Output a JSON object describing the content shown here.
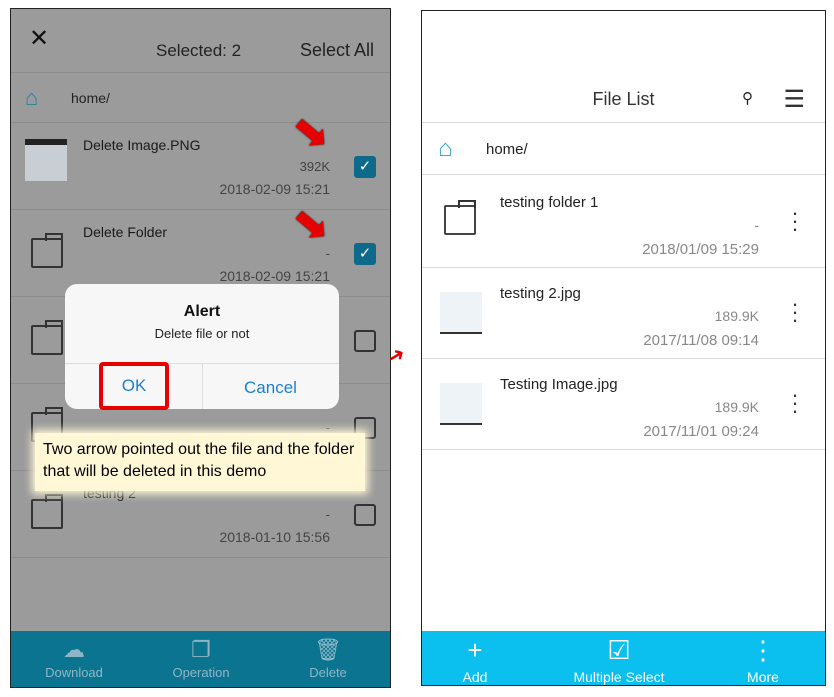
{
  "left": {
    "header": {
      "close_icon": "x",
      "selected": "Selected: 2",
      "select_all": "Select All"
    },
    "path": "home/",
    "rows": [
      {
        "name": "Delete Image.PNG",
        "size": "392K",
        "date": "2018-02-09 15:21",
        "checked": true
      },
      {
        "name": "Delete Folder",
        "size": "-",
        "date": "2018-02-09 15:21",
        "checked": true
      },
      {
        "name": "",
        "size": "",
        "date": "",
        "checked": false
      },
      {
        "name": "",
        "size": "-",
        "date": "",
        "checked": false
      },
      {
        "name": "testing 2",
        "size": "-",
        "date": "2018-01-10 15:56",
        "checked": false
      }
    ],
    "alert": {
      "title": "Alert",
      "message": "Delete file or not",
      "ok": "OK",
      "cancel": "Cancel"
    },
    "note": "Two arrow pointed out the file and the folder that will be deleted in this demo",
    "toolbar": {
      "download": "Download",
      "operation": "Operation",
      "delete": "Delete"
    }
  },
  "right": {
    "title": "File List",
    "path": "home/",
    "rows": [
      {
        "name": "testing folder 1",
        "size": "-",
        "date": "2018/01/09 15:29",
        "type": "folder"
      },
      {
        "name": "testing 2.jpg",
        "size": "189.9K",
        "date": "2017/11/08 09:14",
        "type": "image"
      },
      {
        "name": "Testing Image.jpg",
        "size": "189.9K",
        "date": "2017/11/01 09:24",
        "type": "image"
      }
    ],
    "toolbar": {
      "add": "Add",
      "multiple_select": "Multiple Select",
      "more": "More"
    }
  },
  "colors": {
    "highlight": "#e60000",
    "left_toolbar": "#0b7491",
    "right_toolbar": "#0bbfee",
    "link": "#1a7fd4"
  }
}
